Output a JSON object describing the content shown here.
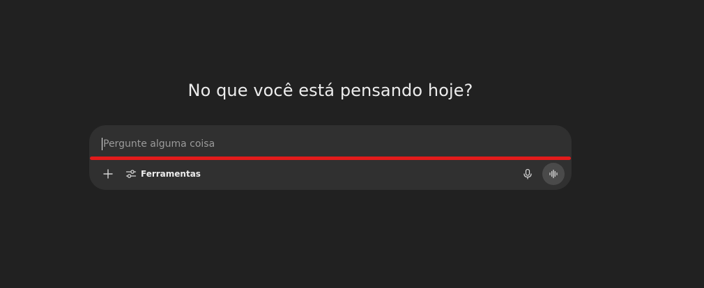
{
  "headline": "No que você está pensando hoje?",
  "composer": {
    "placeholder": "Pergunte alguma coisa",
    "value": "",
    "highlight_color": "#e31b1b",
    "toolbar": {
      "add_icon": "plus-icon",
      "tools_icon": "sliders-icon",
      "tools_label": "Ferramentas",
      "mic_icon": "microphone-icon",
      "voice_icon": "voice-waveform-icon"
    }
  },
  "colors": {
    "background": "#212121",
    "composer_bg": "#303030",
    "text": "#ececec",
    "placeholder": "#9b9b9b",
    "voice_button_bg": "#4a4a4a"
  }
}
